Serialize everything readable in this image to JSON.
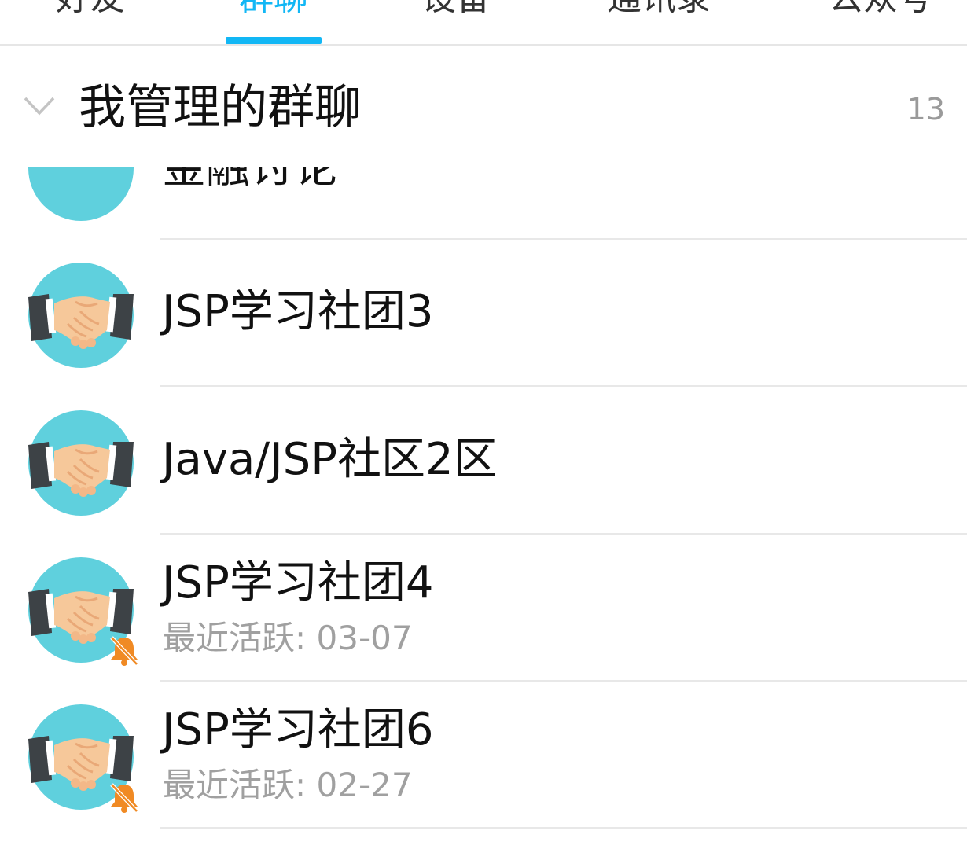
{
  "tabs": [
    {
      "label": "好友",
      "active": false
    },
    {
      "label": "群聊",
      "active": true
    },
    {
      "label": "设备",
      "active": false
    },
    {
      "label": "通讯录",
      "active": false
    },
    {
      "label": "公众号",
      "active": false
    }
  ],
  "accent_color": "#12b7f5",
  "mute_color": "#f08a24",
  "section": {
    "title": "我管理的群聊",
    "count": "13"
  },
  "groups": [
    {
      "name": "金融讨论",
      "avatar": "graduation-cap-avatar",
      "last_active": "",
      "muted": false
    },
    {
      "name": "JSP学习社团3",
      "avatar": "handshake-avatar",
      "last_active": "",
      "muted": false
    },
    {
      "name": "Java/JSP社区2区",
      "avatar": "handshake-avatar",
      "last_active": "",
      "muted": false
    },
    {
      "name": "JSP学习社团4",
      "avatar": "handshake-avatar",
      "last_active": "最近活跃: 03-07",
      "muted": true
    },
    {
      "name": "JSP学习社团6",
      "avatar": "handshake-avatar",
      "last_active": "最近活跃: 02-27",
      "muted": true
    }
  ]
}
